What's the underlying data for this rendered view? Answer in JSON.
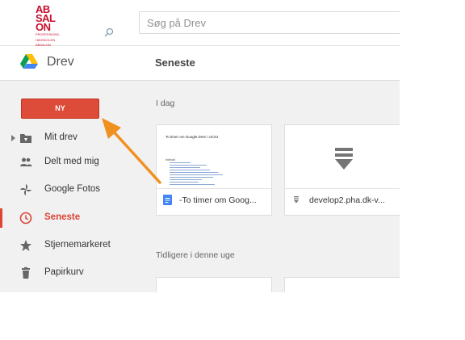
{
  "header": {
    "logo_lines": [
      "AB",
      "SAL",
      "ON"
    ],
    "logo_tagline": [
      "PROFESSIONS-",
      "HØJSKOLEN",
      "ABSALON"
    ],
    "search_placeholder": "Søg på Drev"
  },
  "subheader": {
    "app_name": "Drev",
    "section_title": "Seneste"
  },
  "sidebar": {
    "new_button": "NY",
    "items": [
      {
        "label": "Mit drev",
        "icon": "my-drive-icon"
      },
      {
        "label": "Delt med mig",
        "icon": "shared-people-icon"
      },
      {
        "label": "Google Fotos",
        "icon": "google-photos-icon"
      },
      {
        "label": "Seneste",
        "icon": "clock-icon",
        "active": true
      },
      {
        "label": "Stjernemarkeret",
        "icon": "star-icon"
      },
      {
        "label": "Papirkurv",
        "icon": "trash-icon"
      }
    ]
  },
  "content": {
    "groups": [
      {
        "label": "I dag",
        "files": [
          {
            "name": "-To timer om Goog...",
            "type": "google-doc",
            "preview_title": "To timer om Google Drev i UCSJ",
            "preview_heading": "Indhold:"
          },
          {
            "name": "develop2.pha.dk-v...",
            "type": "file"
          }
        ]
      },
      {
        "label": "Tidligere i denne uge"
      }
    ]
  },
  "colors": {
    "accent_red": "#dd4b39",
    "active_red": "#db4437",
    "annotation_arrow": "#f0901f",
    "doc_blue": "#4285f4"
  }
}
